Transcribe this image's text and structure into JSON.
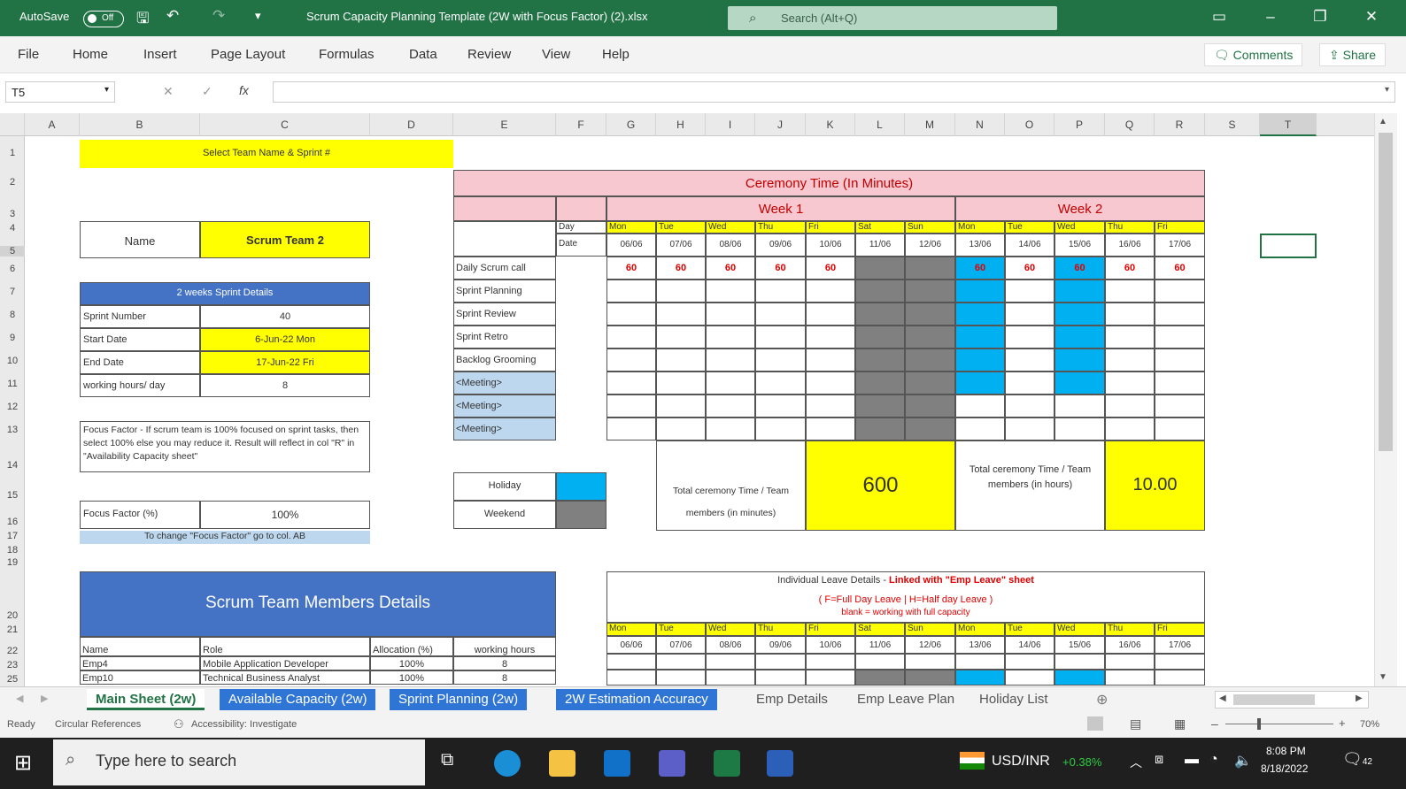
{
  "titlebar": {
    "autosave": "AutoSave",
    "autosave_state": "Off",
    "filename": "Scrum Capacity Planning Template (2W with Focus Factor) (2).xlsx",
    "search_placeholder": "Search (Alt+Q)"
  },
  "ribbon": {
    "tabs": [
      "File",
      "Home",
      "Insert",
      "Page Layout",
      "Formulas",
      "Data",
      "Review",
      "View",
      "Help"
    ],
    "comments": "Comments",
    "share": "Share"
  },
  "formula": {
    "namebox": "T5",
    "fx": "fx"
  },
  "columns": [
    "A",
    "B",
    "C",
    "D",
    "E",
    "F",
    "G",
    "H",
    "I",
    "J",
    "K",
    "L",
    "M",
    "N",
    "O",
    "P",
    "Q",
    "R",
    "S",
    "T"
  ],
  "rows": [
    "1",
    "2",
    "3",
    "4",
    "5",
    "6",
    "7",
    "8",
    "9",
    "10",
    "11",
    "12",
    "13",
    "14",
    "15",
    "16",
    "17",
    "18",
    "19",
    "20",
    "21",
    "22",
    "23",
    "24",
    "25"
  ],
  "left": {
    "select_team": "Select Team Name & Sprint #",
    "name_label": "Name",
    "name_value": "Scrum Team 2",
    "sprint_header": "2 weeks Sprint Details",
    "sprint_rows": [
      {
        "label": "Sprint Number",
        "value": "40"
      },
      {
        "label": "Start Date",
        "value": "6-Jun-22 Mon"
      },
      {
        "label": "End Date",
        "value": "17-Jun-22 Fri"
      },
      {
        "label": "working hours/ day",
        "value": "8"
      }
    ],
    "focus_note": "Focus Factor - If scrum team is 100% focused on sprint tasks, then select 100% else you may reduce it. Result will reflect in col \"R\" in \"Availability Capacity sheet\"",
    "focus_label": "Focus Factor (%)",
    "focus_value": "100%",
    "focus_change": "To change \"Focus Factor\" go to col. AB",
    "members_title": "Scrum Team Members Details",
    "members_headers": [
      "Name",
      "Role",
      "Allocation (%)",
      "working hours"
    ],
    "members": [
      {
        "name": "Emp4",
        "role": "Mobile Application Developer",
        "alloc": "100%",
        "hours": "8"
      },
      {
        "name": "Emp10",
        "role": "Technical Business Analyst",
        "alloc": "100%",
        "hours": "8"
      }
    ]
  },
  "ceremony": {
    "title": "Ceremony Time (In Minutes)",
    "week1": "Week 1",
    "week2": "Week 2",
    "day_label": "Day",
    "date_label": "Date",
    "days": [
      "Mon",
      "Tue",
      "Wed",
      "Thu",
      "Fri",
      "Sat",
      "Sun",
      "Mon",
      "Tue",
      "Wed",
      "Thu",
      "Fri"
    ],
    "dates": [
      "06/06",
      "07/06",
      "08/06",
      "09/06",
      "10/06",
      "11/06",
      "12/06",
      "13/06",
      "14/06",
      "15/06",
      "16/06",
      "17/06"
    ],
    "activities": [
      "Daily Scrum call",
      "Sprint Planning",
      "Sprint Review",
      "Sprint Retro",
      "Backlog Grooming",
      "<Meeting>",
      "<Meeting>",
      "<Meeting>"
    ],
    "daily_values": [
      "60",
      "60",
      "60",
      "60",
      "60",
      "",
      "",
      "60",
      "60",
      "60",
      "60",
      "60"
    ],
    "holiday": "Holiday",
    "weekend": "Weekend",
    "total_min_label": "Total ceremony Time / Team members (in minutes)",
    "total_min": "600",
    "total_hr_label": "Total ceremony Time / Team members (in hours)",
    "total_hr": "10.00"
  },
  "leave": {
    "title": "Individual Leave Details -",
    "title_red": "Linked with \"Emp Leave\" sheet",
    "legend1": "( F=Full Day Leave | H=Half day Leave )",
    "legend2": "blank = working with full capacity",
    "days": [
      "Mon",
      "Tue",
      "Wed",
      "Thu",
      "Fri",
      "Sat",
      "Sun",
      "Mon",
      "Tue",
      "Wed",
      "Thu",
      "Fri"
    ],
    "dates": [
      "06/06",
      "07/06",
      "08/06",
      "09/06",
      "10/06",
      "11/06",
      "12/06",
      "13/06",
      "14/06",
      "15/06",
      "16/06",
      "17/06"
    ]
  },
  "sheets": [
    "Main Sheet (2w)",
    "Available Capacity (2w)",
    "Sprint Planning (2w)",
    "2W Estimation Accuracy",
    "Emp Details",
    "Emp Leave Plan",
    "Holiday List"
  ],
  "status": {
    "ready": "Ready",
    "circular": "Circular References",
    "accessibility": "Accessibility: Investigate",
    "zoom": "70%"
  },
  "taskbar": {
    "search": "Type here to search",
    "currency": "USD/INR",
    "change": "+0.38%",
    "time": "8:08 PM",
    "date": "8/18/2022",
    "notif": "42"
  }
}
